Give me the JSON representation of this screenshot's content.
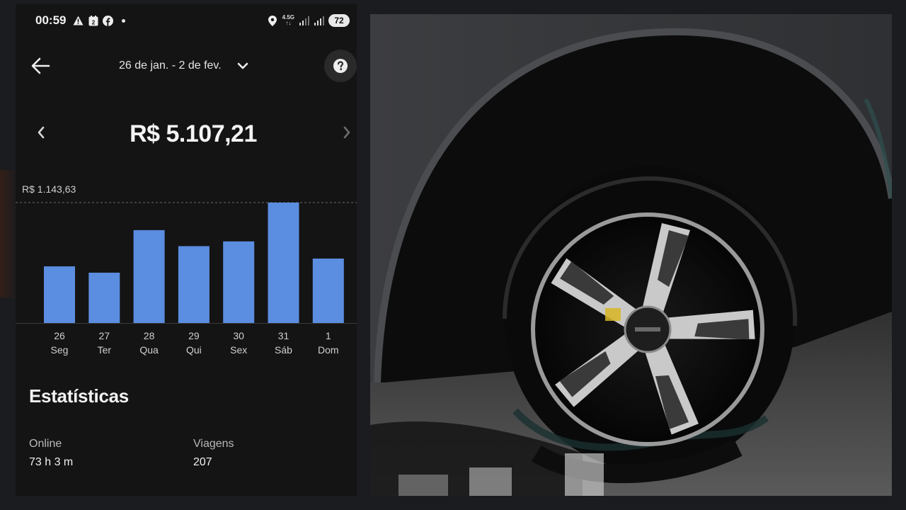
{
  "status_bar": {
    "time": "00:59",
    "calendar_badge": "2",
    "network_top": "4.5G",
    "network_bottom": "↑↓",
    "battery": "72"
  },
  "header": {
    "date_range": "26 de jan. - 2 de fev."
  },
  "earnings": {
    "total": "R$ 5.107,21"
  },
  "chart_data": {
    "type": "bar",
    "max_label": "R$ 1.143,63",
    "days": [
      "26",
      "27",
      "28",
      "29",
      "30",
      "31",
      "1"
    ],
    "weekdays": [
      "Seg",
      "Ter",
      "Qua",
      "Qui",
      "Sex",
      "Sáb",
      "Dom"
    ],
    "values": [
      538,
      478,
      882,
      730,
      775,
      1143.63,
      612
    ],
    "ymax": 1143.63,
    "bar_color": "#5b8de0"
  },
  "stats": {
    "title": "Estatísticas",
    "online_label": "Online",
    "online_value": "73 h 3 m",
    "trips_label": "Viagens",
    "trips_value": "207"
  }
}
